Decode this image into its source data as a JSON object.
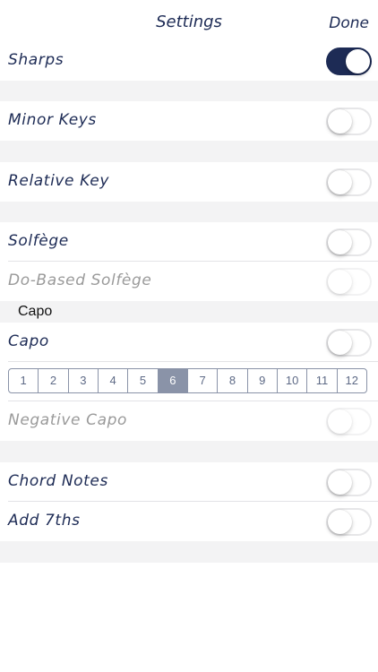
{
  "nav": {
    "title": "Settings",
    "done_label": "Done"
  },
  "rows": {
    "sharps": {
      "label": "Sharps",
      "on": true
    },
    "minor_keys": {
      "label": "Minor Keys",
      "on": false
    },
    "relative_key": {
      "label": "Relative Key",
      "on": false
    },
    "solfege": {
      "label": "Solfège",
      "on": false
    },
    "do_based_solfege": {
      "label": "Do-Based Solfège",
      "on": false,
      "disabled": true
    },
    "capo": {
      "label": "Capo",
      "on": false
    },
    "negative_capo": {
      "label": "Negative Capo",
      "on": false,
      "disabled": true
    },
    "chord_notes": {
      "label": "Chord Notes",
      "on": false
    },
    "add_7ths": {
      "label": "Add 7ths",
      "on": false
    }
  },
  "capo_section_header": "Capo",
  "capo_segments": {
    "options": [
      "1",
      "2",
      "3",
      "4",
      "5",
      "6",
      "7",
      "8",
      "9",
      "10",
      "11",
      "12"
    ],
    "selected": "6"
  },
  "colors": {
    "accent": "#1d2b55",
    "segment": "#8a93a8",
    "group_bg": "#f3f3f4"
  }
}
